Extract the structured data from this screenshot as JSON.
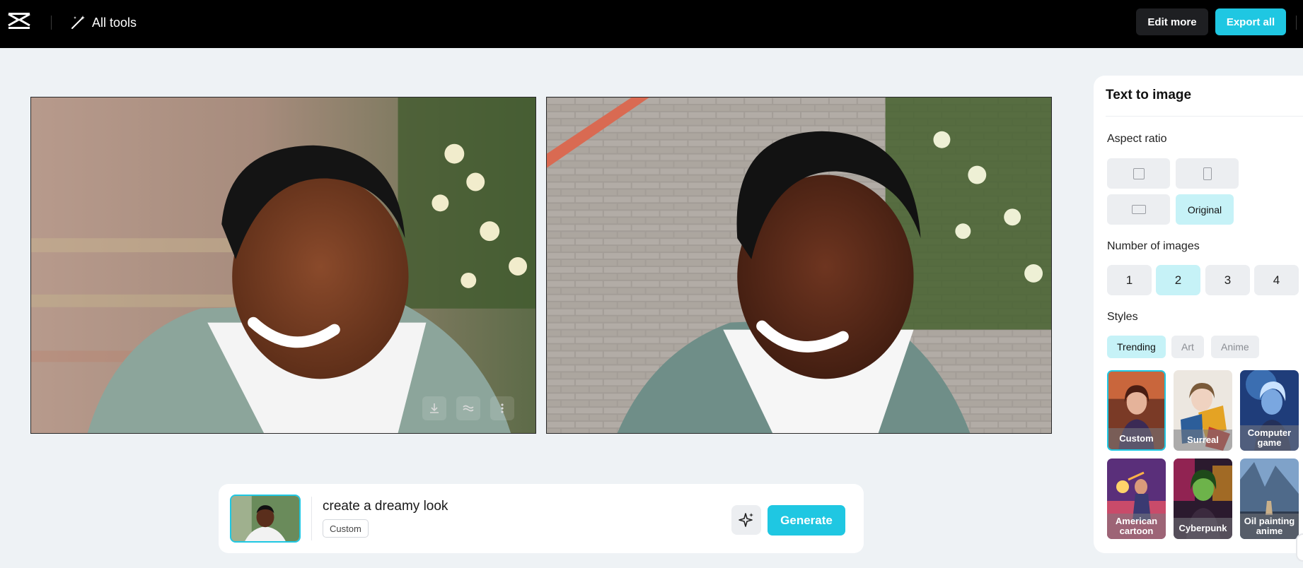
{
  "topbar": {
    "logo_icon": "capcut-logo-icon",
    "all_tools_label": "All tools",
    "edit_more_label": "Edit more",
    "export_all_label": "Export all"
  },
  "images": [
    {
      "id": "result-1",
      "actions": [
        "download-icon",
        "stylize-icon",
        "more-icon"
      ]
    },
    {
      "id": "result-2",
      "actions": []
    }
  ],
  "prompt": {
    "text": "create a dreamy look",
    "style_chip": "Custom",
    "generate_label": "Generate"
  },
  "panel": {
    "title": "Text to image",
    "aspect_ratio_label": "Aspect ratio",
    "aspect_ratio_selected": "Original",
    "num_images_label": "Number of images",
    "num_images": [
      "1",
      "2",
      "3",
      "4"
    ],
    "num_images_selected": "2",
    "styles_label": "Styles",
    "style_tabs": [
      "Trending",
      "Art",
      "Anime"
    ],
    "style_tab_selected": "Trending",
    "styles": [
      "Custom",
      "Surreal",
      "Computer game",
      "American cartoon",
      "Cyberpunk",
      "Oil painting anime"
    ],
    "style_selected": "Custom"
  },
  "colors": {
    "accent": "#1fc7e2",
    "accent_light": "#c6f2f7",
    "topbar_bg": "#000000",
    "page_bg": "#eef2f5"
  }
}
